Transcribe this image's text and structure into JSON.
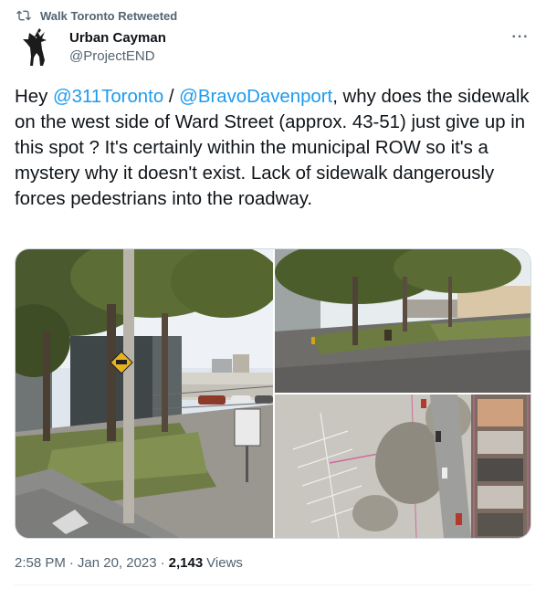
{
  "retweet": {
    "label": "Walk Toronto Retweeted",
    "icon": "retweet-icon"
  },
  "author": {
    "name": "Urban Cayman",
    "handle": "@ProjectEND",
    "avatar_icon": "alligator-figure-avatar"
  },
  "more_menu": {
    "label": "···",
    "icon": "more-options-icon"
  },
  "tweet": {
    "text_prefix": "Hey ",
    "mention_1": "@311Toronto",
    "between_mentions": " / ",
    "mention_2": "@BravoDavenport",
    "text_body": ", why does the sidewalk on the west side of Ward Street (approx. 43-51) just give up in this spot ? It's certainly within the municipal ROW so it's a mystery why it doesn't exist. Lack of sidewalk dangerously forces pedestrians into the roadway."
  },
  "media": {
    "photos": [
      {
        "description_icon": "street-photo-sidewalk-end"
      },
      {
        "description_icon": "street-photo-parking-lot"
      },
      {
        "description_icon": "aerial-map-photo"
      }
    ]
  },
  "meta": {
    "time": "2:58 PM",
    "separator": "·",
    "date": "Jan 20, 2023",
    "views_count": "2,143",
    "views_label": "Views"
  },
  "colors": {
    "link": "#1d9bf0",
    "secondary_text": "#536471",
    "primary_text": "#0f1419",
    "border": "#cfd9de"
  }
}
